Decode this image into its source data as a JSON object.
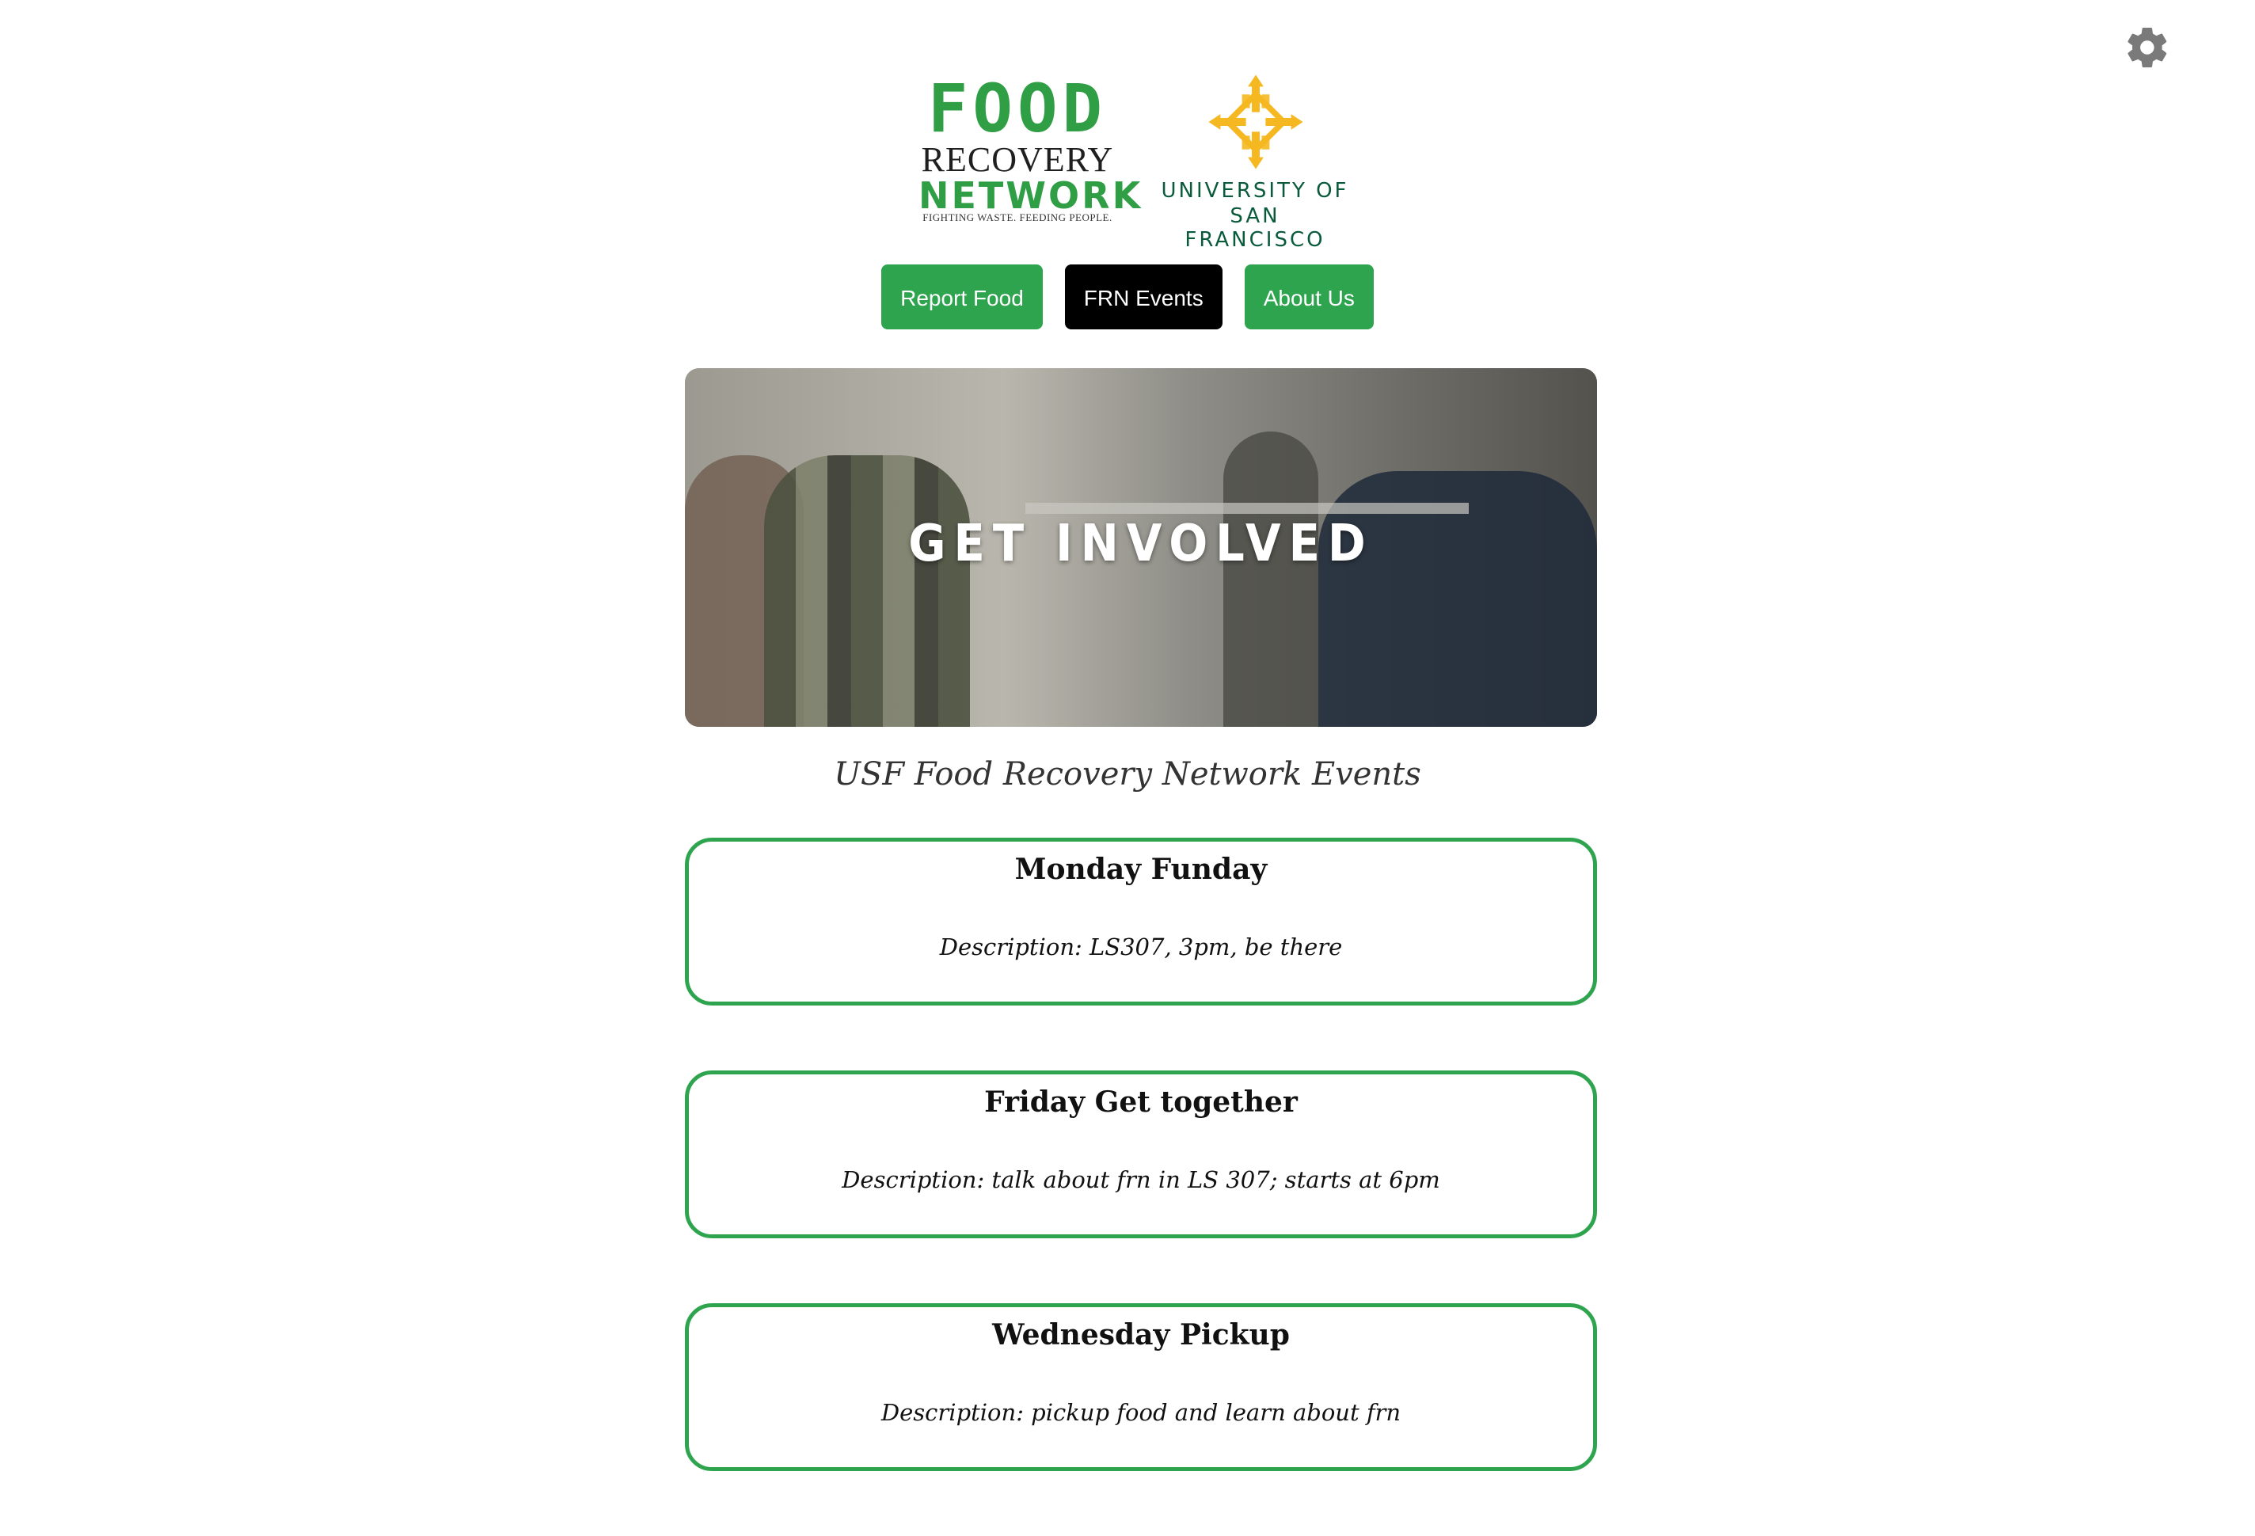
{
  "settings": {
    "icon": "gear-icon"
  },
  "logos": {
    "frn": {
      "line1": "FOOD",
      "line2": "RECOVERY",
      "line3": "NETWORK",
      "tagline": "FIGHTING WASTE. FEEDING PEOPLE."
    },
    "usf": {
      "line1": "UNIVERSITY OF",
      "line2": "SAN FRANCISCO"
    }
  },
  "nav": [
    {
      "label": "Report Food",
      "active": false
    },
    {
      "label": "FRN Events",
      "active": true
    },
    {
      "label": "About Us",
      "active": false
    }
  ],
  "hero": {
    "title": "GET INVOLVED"
  },
  "page_heading": "USF Food Recovery Network Events",
  "events": [
    {
      "title": "Monday Funday",
      "description": "Description: LS307, 3pm, be there"
    },
    {
      "title": "Friday Get together",
      "description": "Description: talk about frn in LS 307; starts at 6pm"
    },
    {
      "title": "Wednesday Pickup",
      "description": "Description: pickup food and learn about frn"
    }
  ],
  "colors": {
    "brand_green": "#2ea44f",
    "usf_gold": "#f5b820",
    "usf_green": "#0a5a3c",
    "active_nav": "#000000"
  }
}
